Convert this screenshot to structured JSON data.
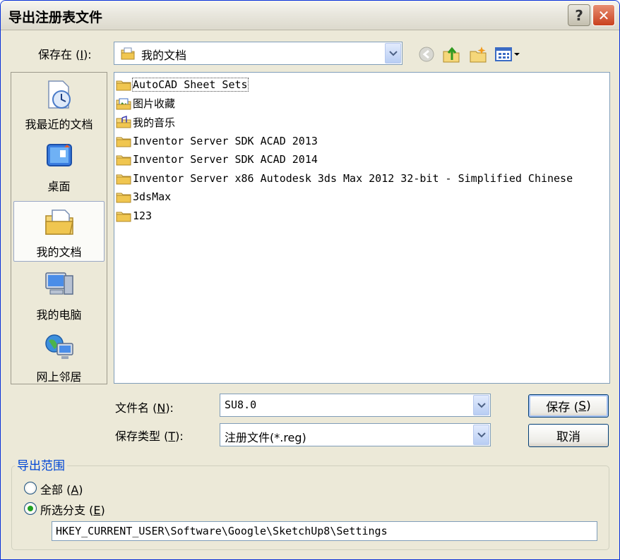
{
  "window": {
    "title": "导出注册表文件",
    "help_glyph": "?",
    "close_glyph": "✕"
  },
  "look_in": {
    "label_prefix": "保存在 (",
    "label_key": "I",
    "label_suffix": "):",
    "value": "我的文档"
  },
  "toolbar": {
    "icons": [
      "back-icon",
      "up-folder-icon",
      "new-folder-icon",
      "view-menu-icon"
    ]
  },
  "places": [
    {
      "name": "recent",
      "label": "我最近的文档",
      "icon": "recent-documents-icon"
    },
    {
      "name": "desktop",
      "label": "桌面",
      "icon": "desktop-icon"
    },
    {
      "name": "my-documents",
      "label": "我的文档",
      "icon": "my-documents-icon",
      "active": true
    },
    {
      "name": "my-computer",
      "label": "我的电脑",
      "icon": "my-computer-icon"
    },
    {
      "name": "network",
      "label": "网上邻居",
      "icon": "network-places-icon"
    }
  ],
  "files": [
    {
      "name": "AutoCAD Sheet Sets",
      "type": "folder",
      "cjk": false
    },
    {
      "name": "图片收藏",
      "type": "pictures-folder",
      "cjk": true
    },
    {
      "name": "我的音乐",
      "type": "music-folder",
      "cjk": true
    },
    {
      "name": "Inventor Server SDK ACAD 2013",
      "type": "folder",
      "cjk": false
    },
    {
      "name": "Inventor Server SDK ACAD 2014",
      "type": "folder",
      "cjk": false
    },
    {
      "name": "Inventor Server x86 Autodesk 3ds Max 2012 32-bit - Simplified Chinese",
      "type": "folder",
      "cjk": false
    },
    {
      "name": "3dsMax",
      "type": "folder",
      "cjk": false
    },
    {
      "name": "123",
      "type": "folder",
      "cjk": false
    }
  ],
  "filename": {
    "label_prefix": "文件名 (",
    "label_key": "N",
    "label_suffix": "):",
    "value": "SU8.0"
  },
  "filetype": {
    "label_prefix": "保存类型 (",
    "label_key": "T",
    "label_suffix": "):",
    "value": "注册文件(*.reg)"
  },
  "buttons": {
    "save_prefix": "保存 (",
    "save_key": "S",
    "save_suffix": ")",
    "cancel": "取消"
  },
  "export_range": {
    "legend": "导出范围",
    "all_prefix": "全部 (",
    "all_key": "A",
    "all_suffix": ")",
    "branch_prefix": "所选分支 (",
    "branch_key": "E",
    "branch_suffix": ")",
    "selected": "branch",
    "branch_path": "HKEY_CURRENT_USER\\Software\\Google\\SketchUp8\\Settings"
  },
  "colors": {
    "dialog_bg": "#ece9d8",
    "accent_blue": "#0046d5",
    "field_border": "#7f9db9",
    "radio_dot": "#21a121"
  }
}
